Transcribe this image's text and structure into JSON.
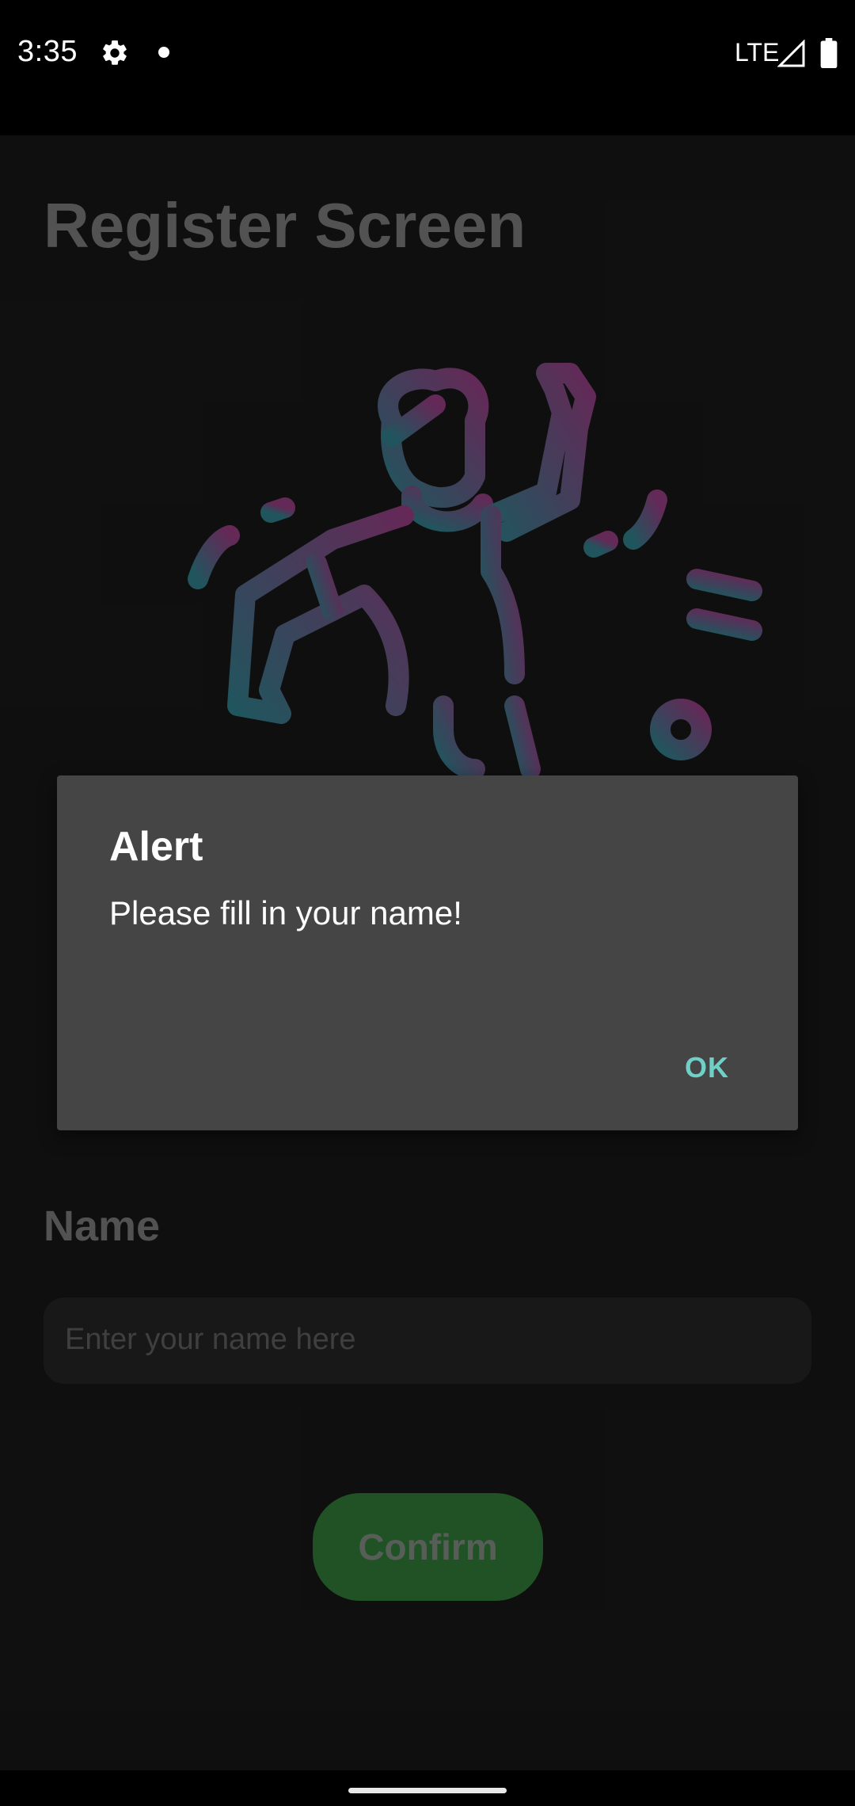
{
  "status_bar": {
    "time": "3:35",
    "network": "LTE"
  },
  "screen": {
    "title": "Register Screen",
    "illustration": "person-dancing-music-illustration",
    "name_label": "Name",
    "name_input": {
      "value": "",
      "placeholder": "Enter your name here"
    },
    "confirm_label": "Confirm"
  },
  "dialog": {
    "title": "Alert",
    "message": "Please fill in your name!",
    "ok_label": "OK"
  },
  "colors": {
    "dialog_background": "#454545",
    "dialog_button_text": "#6fd0c8",
    "confirm_button": "#3f9e48",
    "illustration_gradient_start": "#3fa3b3",
    "illustration_gradient_end": "#c04fa8"
  },
  "icons": [
    "settings-gear-icon",
    "notification-dot-icon",
    "signal-icon",
    "battery-icon"
  ]
}
